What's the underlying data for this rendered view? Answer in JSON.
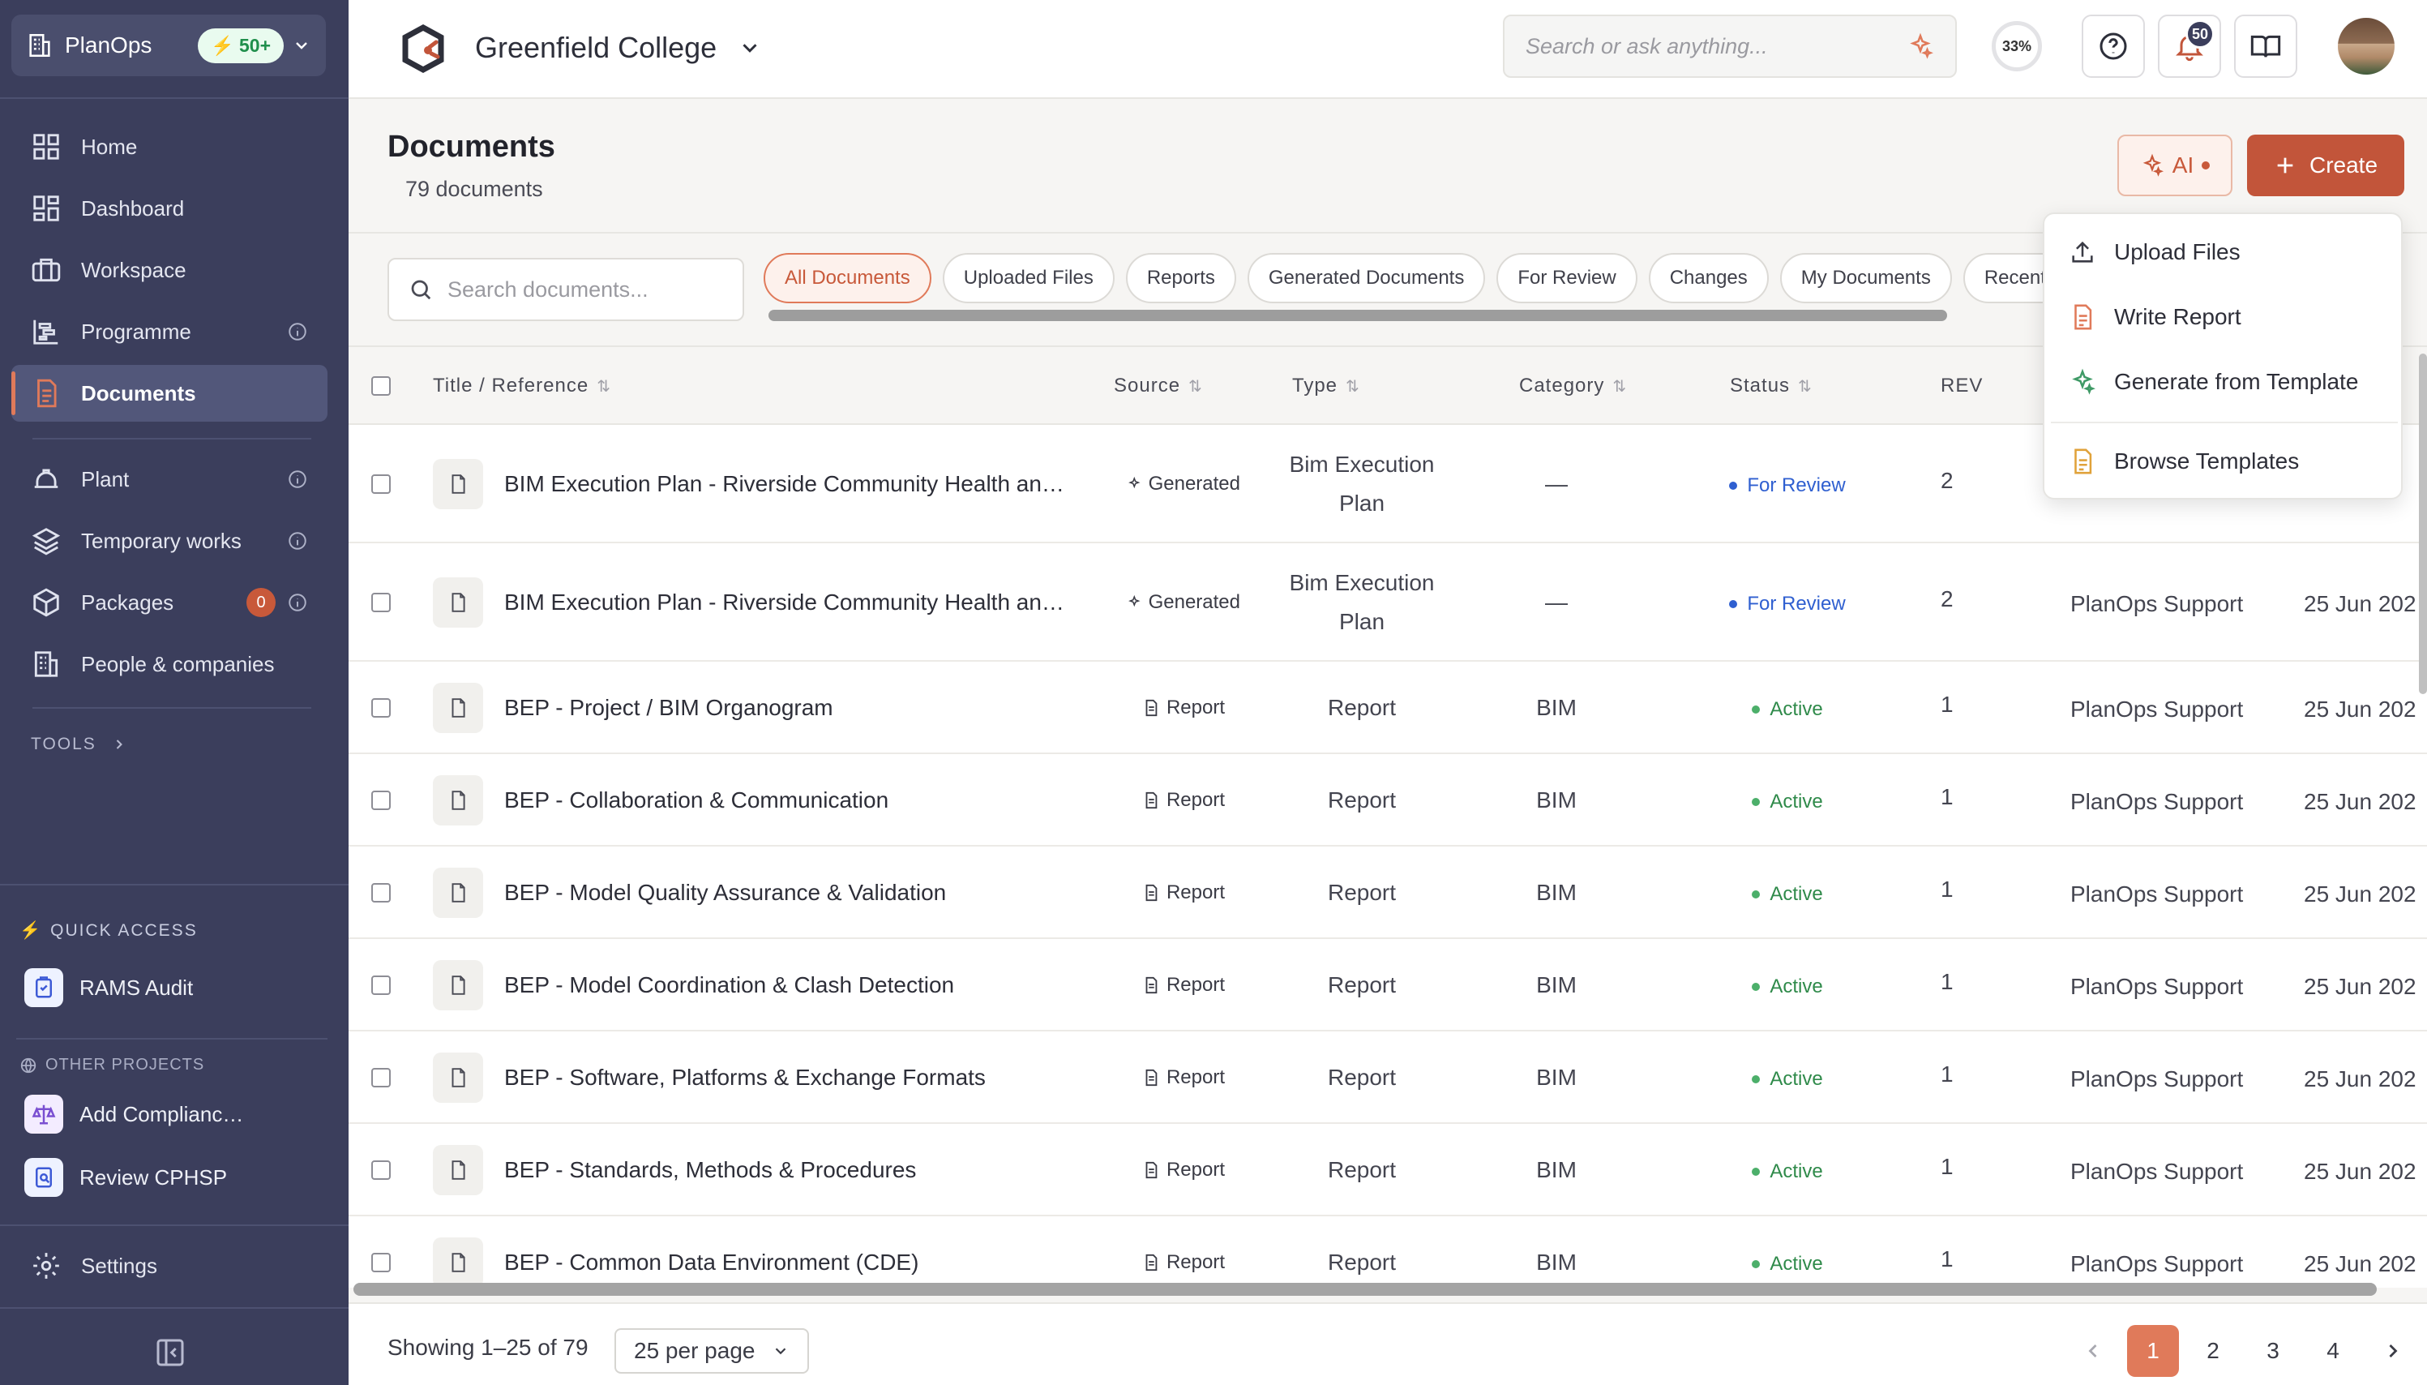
{
  "sidebar": {
    "workspace": {
      "name": "PlanOps",
      "badge": "50+"
    },
    "nav": [
      {
        "id": "home",
        "label": "Home",
        "icon": "grid-icon"
      },
      {
        "id": "dashboard",
        "label": "Dashboard",
        "icon": "dashboard-icon"
      },
      {
        "id": "workspace",
        "label": "Workspace",
        "icon": "briefcase-icon"
      },
      {
        "id": "programme",
        "label": "Programme",
        "icon": "gantt-icon"
      },
      {
        "id": "documents",
        "label": "Documents",
        "icon": "document-icon"
      }
    ],
    "nav2": [
      {
        "id": "plant",
        "label": "Plant",
        "icon": "helmet-icon"
      },
      {
        "id": "temporary-works",
        "label": "Temporary works",
        "icon": "layers-icon"
      },
      {
        "id": "packages",
        "label": "Packages",
        "icon": "package-icon",
        "count": "0"
      },
      {
        "id": "people",
        "label": "People & companies",
        "icon": "building-icon"
      }
    ],
    "tools_label": "TOOLS",
    "quick_access_label": "QUICK ACCESS",
    "quick_access": [
      {
        "label": "RAMS Audit"
      }
    ],
    "other_projects_label": "OTHER PROJECTS",
    "other_projects": [
      {
        "label": "Add Complianc…"
      },
      {
        "label": "Review CPHSP"
      }
    ],
    "settings_label": "Settings"
  },
  "topbar": {
    "project_name": "Greenfield College",
    "search_placeholder": "Search or ask anything...",
    "progress": "33%",
    "notifications": "50"
  },
  "page": {
    "title": "Documents",
    "subtitle": "79 documents",
    "ai_label": "AI",
    "create_label": "Create",
    "search_placeholder": "Search documents...",
    "filters": [
      "All Documents",
      "Uploaded Files",
      "Reports",
      "Generated Documents",
      "For Review",
      "Changes",
      "My Documents",
      "Recent"
    ]
  },
  "create_menu": {
    "items": [
      "Upload Files",
      "Write Report",
      "Generate from Template"
    ],
    "browse": "Browse Templates"
  },
  "table": {
    "headers": {
      "title": "Title / Reference",
      "source": "Source",
      "type": "Type",
      "category": "Category",
      "status": "Status",
      "rev": "REV"
    },
    "rows": [
      {
        "title": "BIM Execution Plan - Riverside Community Health an…",
        "source": "Generated",
        "type_a": "Bim Execution",
        "type_b": "Plan",
        "category": "—",
        "status": "For Review",
        "rev": "2",
        "by": "",
        "date": ""
      },
      {
        "title": "BIM Execution Plan - Riverside Community Health an…",
        "source": "Generated",
        "type_a": "Bim Execution",
        "type_b": "Plan",
        "category": "—",
        "status": "For Review",
        "rev": "2",
        "by": "PlanOps Support",
        "date": "25 Jun 202"
      },
      {
        "title": "BEP - Project / BIM Organogram",
        "source": "Report",
        "type_a": "Report",
        "type_b": "",
        "category": "BIM",
        "status": "Active",
        "rev": "1",
        "by": "PlanOps Support",
        "date": "25 Jun 202"
      },
      {
        "title": "BEP - Collaboration & Communication",
        "source": "Report",
        "type_a": "Report",
        "type_b": "",
        "category": "BIM",
        "status": "Active",
        "rev": "1",
        "by": "PlanOps Support",
        "date": "25 Jun 202"
      },
      {
        "title": "BEP - Model Quality Assurance & Validation",
        "source": "Report",
        "type_a": "Report",
        "type_b": "",
        "category": "BIM",
        "status": "Active",
        "rev": "1",
        "by": "PlanOps Support",
        "date": "25 Jun 202"
      },
      {
        "title": "BEP - Model Coordination & Clash Detection",
        "source": "Report",
        "type_a": "Report",
        "type_b": "",
        "category": "BIM",
        "status": "Active",
        "rev": "1",
        "by": "PlanOps Support",
        "date": "25 Jun 202"
      },
      {
        "title": "BEP - Software, Platforms & Exchange Formats",
        "source": "Report",
        "type_a": "Report",
        "type_b": "",
        "category": "BIM",
        "status": "Active",
        "rev": "1",
        "by": "PlanOps Support",
        "date": "25 Jun 202"
      },
      {
        "title": "BEP - Standards, Methods & Procedures",
        "source": "Report",
        "type_a": "Report",
        "type_b": "",
        "category": "BIM",
        "status": "Active",
        "rev": "1",
        "by": "PlanOps Support",
        "date": "25 Jun 202"
      },
      {
        "title": "BEP - Common Data Environment (CDE)",
        "source": "Report",
        "type_a": "Report",
        "type_b": "",
        "category": "BIM",
        "status": "Active",
        "rev": "1",
        "by": "PlanOps Support",
        "date": "25 Jun 202"
      }
    ]
  },
  "footer": {
    "showing": "Showing 1–25 of 79",
    "per_page": "25 per page",
    "pages": [
      "1",
      "2",
      "3",
      "4"
    ]
  },
  "colors": {
    "sidebar": "#3b3e5c",
    "accent": "#c2553a",
    "active_status": "#2f8a4a",
    "review_status": "#2f5fd0"
  }
}
